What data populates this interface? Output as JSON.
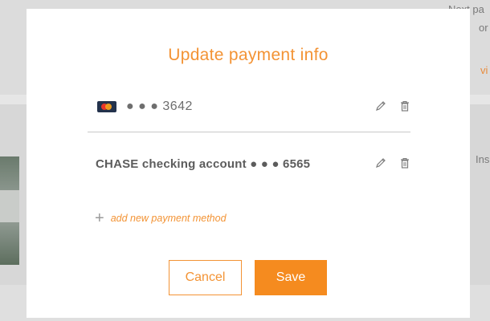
{
  "background": {
    "top_right_text_1": "Next pa",
    "top_right_text_2": "or",
    "top_right_link": "vi",
    "right_side_text": "Ins"
  },
  "modal": {
    "title": "Update payment info",
    "methods": [
      {
        "icon": "mastercard-icon",
        "label": "● ● ● 3642"
      },
      {
        "label": "CHASE checking account ● ● ● 6565"
      }
    ],
    "add_label": "add new payment method",
    "cancel_label": "Cancel",
    "save_label": "Save"
  },
  "colors": {
    "accent": "#f39334",
    "save_bg": "#f58b1f"
  }
}
